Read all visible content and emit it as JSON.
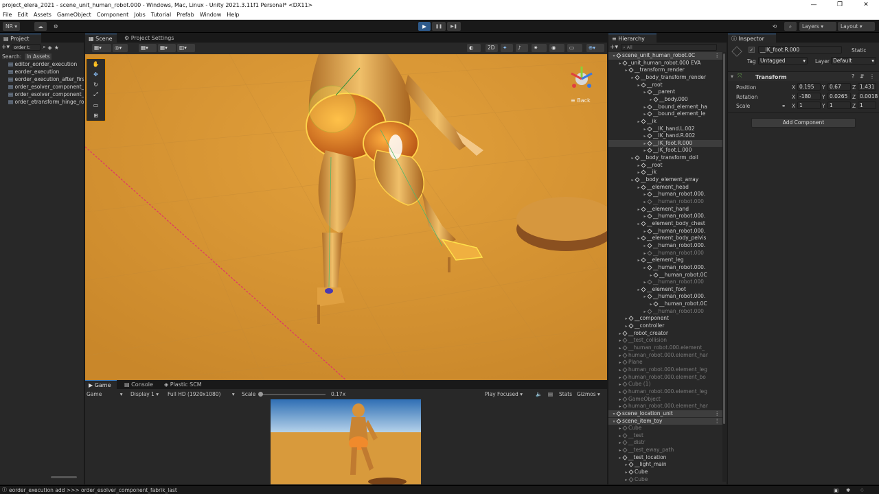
{
  "window": {
    "title": "project_elera_2021 - scene_unit_human_robot.000 - Windows, Mac, Linux - Unity 2021.3.11f1 Personal* <DX11>",
    "minimize": "—",
    "maximize": "❐",
    "close": "✕"
  },
  "menu": [
    "File",
    "Edit",
    "Assets",
    "GameObject",
    "Component",
    "Jobs",
    "Tutorial",
    "Prefab",
    "Window",
    "Help"
  ],
  "toolbar": {
    "account": "NR ▾",
    "layers": "Layers",
    "layout": "Layout",
    "play": "▶",
    "pause": "❚❚",
    "step": "▶❚"
  },
  "project": {
    "tab": "Project",
    "search_value": "order t:",
    "search_label": "Search:",
    "search_scope": "In Assets",
    "items": [
      "editor_eorder_execution",
      "eorder_execution",
      "eorder_execution_after_firs",
      "order_esolver_component_",
      "order_esolver_component_",
      "order_etransform_hinge_rot"
    ]
  },
  "scene_view": {
    "tab_scene": "Scene",
    "tab_settings": "Project Settings",
    "mode_2d": "2D",
    "gizmo_back": "≡ Back"
  },
  "game_view": {
    "tab_game": "Game",
    "tab_console": "Console",
    "tab_plastic": "Plastic SCM",
    "display_mode": "Game",
    "display": "Display 1",
    "resolution": "Full HD (1920x1080)",
    "scale_label": "Scale",
    "scale_value": "0.17x",
    "play_focused": "Play Focused",
    "stats": "Stats",
    "gizmos": "Gizmos"
  },
  "hierarchy": {
    "tab": "Hierarchy",
    "search": "All",
    "rows": [
      {
        "t": "scene_unit_human_robot.0C",
        "d": 0,
        "k": "scene"
      },
      {
        "t": "_unit_human_robot.000 EVA",
        "d": 1,
        "k": "n"
      },
      {
        "t": "__transform_render",
        "d": 2,
        "k": "n"
      },
      {
        "t": "__body_transform_render",
        "d": 3,
        "k": "n"
      },
      {
        "t": "__root",
        "d": 4,
        "k": "n"
      },
      {
        "t": "__parent",
        "d": 5,
        "k": "n"
      },
      {
        "t": "__body.000",
        "d": 6,
        "k": "n"
      },
      {
        "t": "__bound_element_ha",
        "d": 5,
        "k": "n"
      },
      {
        "t": "__bound_element_le",
        "d": 5,
        "k": "n"
      },
      {
        "t": "__ik",
        "d": 4,
        "k": "n"
      },
      {
        "t": "__IK_hand.L.002",
        "d": 5,
        "k": "n"
      },
      {
        "t": "__IK_hand.R.002",
        "d": 5,
        "k": "n"
      },
      {
        "t": "__IK_foot.R.000",
        "d": 5,
        "k": "sel"
      },
      {
        "t": "__IK_foot.L.000",
        "d": 5,
        "k": "n"
      },
      {
        "t": "__body_transform_doll",
        "d": 3,
        "k": "n"
      },
      {
        "t": "__root",
        "d": 4,
        "k": "n"
      },
      {
        "t": "__ik",
        "d": 4,
        "k": "n"
      },
      {
        "t": "__body_element_array",
        "d": 3,
        "k": "n"
      },
      {
        "t": "__element_head",
        "d": 4,
        "k": "n"
      },
      {
        "t": "__human_robot.000.",
        "d": 5,
        "k": "n"
      },
      {
        "t": "__human_robot.000",
        "d": 5,
        "k": "dim"
      },
      {
        "t": "__element_hand",
        "d": 4,
        "k": "n"
      },
      {
        "t": "__human_robot.000.",
        "d": 5,
        "k": "n"
      },
      {
        "t": "__element_body_chest",
        "d": 4,
        "k": "n"
      },
      {
        "t": "__human_robot.000.",
        "d": 5,
        "k": "n"
      },
      {
        "t": "__element_body_pelvis",
        "d": 4,
        "k": "n"
      },
      {
        "t": "__human_robot.000.",
        "d": 5,
        "k": "n"
      },
      {
        "t": "__human_robot.000",
        "d": 5,
        "k": "dim"
      },
      {
        "t": "__element_leg",
        "d": 4,
        "k": "n"
      },
      {
        "t": "__human_robot.000.",
        "d": 5,
        "k": "n"
      },
      {
        "t": "__human_robot.0C",
        "d": 6,
        "k": "n"
      },
      {
        "t": "__human_robot.000",
        "d": 5,
        "k": "dim"
      },
      {
        "t": "__element_foot",
        "d": 4,
        "k": "n"
      },
      {
        "t": "__human_robot.000.",
        "d": 5,
        "k": "n"
      },
      {
        "t": "__human_robot.0C",
        "d": 6,
        "k": "n"
      },
      {
        "t": "__human_robot.000",
        "d": 5,
        "k": "dim"
      },
      {
        "t": "__component",
        "d": 2,
        "k": "n"
      },
      {
        "t": "__controller",
        "d": 2,
        "k": "n"
      },
      {
        "t": "__robot_creator",
        "d": 1,
        "k": "n"
      },
      {
        "t": "__test_collision",
        "d": 1,
        "k": "dim"
      },
      {
        "t": "__human_robot.000.element_",
        "d": 1,
        "k": "dim"
      },
      {
        "t": "human_robot.000.element_har",
        "d": 1,
        "k": "dim"
      },
      {
        "t": "Plane",
        "d": 1,
        "k": "dim"
      },
      {
        "t": "human_robot.000.element_leg",
        "d": 1,
        "k": "dim"
      },
      {
        "t": "human_robot.000.element_bo",
        "d": 1,
        "k": "dim"
      },
      {
        "t": "Cube (1)",
        "d": 1,
        "k": "dim"
      },
      {
        "t": "human_robot.000.element_leg",
        "d": 1,
        "k": "dim"
      },
      {
        "t": "GameObject",
        "d": 1,
        "k": "dim"
      },
      {
        "t": "human_robot.000.element_har",
        "d": 1,
        "k": "dim"
      },
      {
        "t": "scene_location_unit",
        "d": 0,
        "k": "scene"
      },
      {
        "t": "scene_item_toy",
        "d": 0,
        "k": "scene"
      },
      {
        "t": "Cube",
        "d": 1,
        "k": "dim"
      },
      {
        "t": "__test",
        "d": 1,
        "k": "dim"
      },
      {
        "t": "__distr",
        "d": 1,
        "k": "dim"
      },
      {
        "t": "__test_eway_path",
        "d": 1,
        "k": "dim"
      },
      {
        "t": "__test_location",
        "d": 1,
        "k": "n"
      },
      {
        "t": "__light_main",
        "d": 2,
        "k": "n"
      },
      {
        "t": "Cube",
        "d": 2,
        "k": "n"
      },
      {
        "t": "Cube",
        "d": 2,
        "k": "dim"
      }
    ]
  },
  "inspector": {
    "tab": "Inspector",
    "object_name": "__IK_foot.R.000",
    "static": "Static",
    "tag_label": "Tag",
    "tag": "Untagged",
    "layer_label": "Layer",
    "layer": "Default",
    "component": "Transform",
    "position_label": "Position",
    "rotation_label": "Rotation",
    "scale_label": "Scale",
    "position": {
      "x": "0.195",
      "y": "0.67",
      "z": "1.431"
    },
    "rotation": {
      "x": "-180",
      "y": "0.0265",
      "z": "0.0018"
    },
    "scale": {
      "x": "1",
      "y": "1",
      "z": "1"
    },
    "add_component": "Add Component"
  },
  "status": {
    "message": "eorder_execution add >>> order_esolver_component_fabrik_last"
  }
}
